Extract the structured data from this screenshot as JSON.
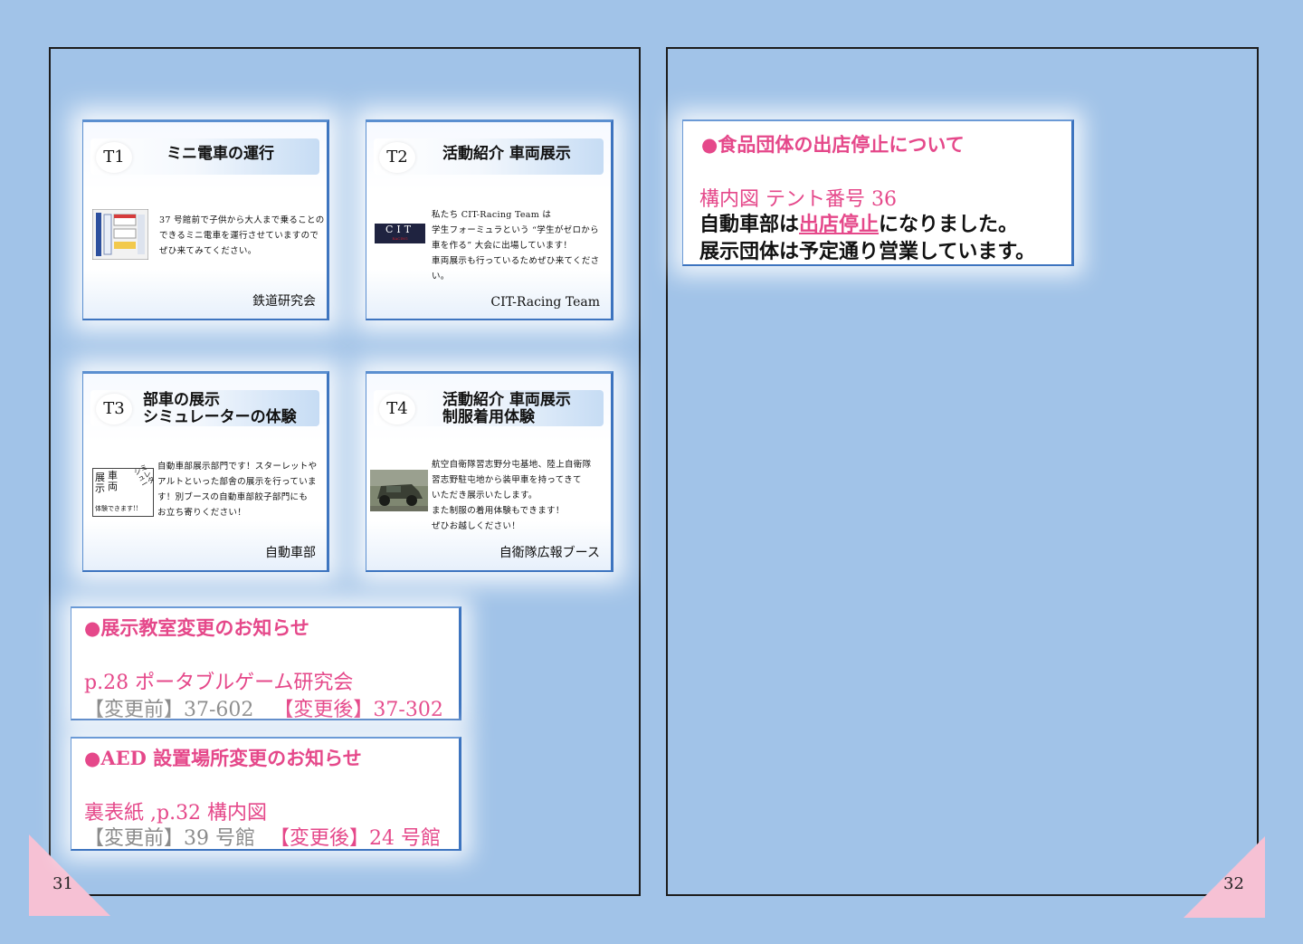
{
  "pages": {
    "left_number": "31",
    "right_number": "32"
  },
  "cards": [
    {
      "code": "T1",
      "title": "ミニ電車の運行",
      "body": [
        "37 号館前で子供から大人まで乗ることの",
        "できるミニ電車を運行させていますので",
        "ぜひ来てみてください。"
      ],
      "org": "鉄道研究会",
      "thumb_icon": "mini-train-sign"
    },
    {
      "code": "T2",
      "title": "活動紹介 車両展示",
      "body": [
        "私たち CIT-Racing Team は",
        "学生フォーミュラという “学生がゼロから",
        "車を作る” 大会に出場しています！",
        "車両展示も行っているためぜひ来てください。"
      ],
      "org": "CIT-Racing Team",
      "logo": {
        "main": "CIT",
        "sub": "RACING"
      }
    },
    {
      "code": "T3",
      "title_line1": "部車の展示",
      "title_line2": "シミュレーターの体験",
      "body": [
        "自動車部展示部門です！スターレットや",
        "アルトといった部舎の展示を行っていま",
        "す！別ブースの自動車部餃子部門にも",
        "お立ち寄りください！"
      ],
      "org": "自動車部",
      "sign": {
        "col1": "展示",
        "col2": "車両",
        "col3": "体験できます!!",
        "side": "シミュレータ"
      }
    },
    {
      "code": "T4",
      "title_line1": "活動紹介 車両展示",
      "title_line2": "制服着用体験",
      "body": [
        "航空自衛隊習志野分屯基地、陸上自衛隊",
        "習志野駐屯地から装甲車を持ってきて",
        "いただき展示いたします。",
        "また制服の着用体験もできます！",
        "ぜひお越しください！"
      ],
      "org": "自衛隊広報ブース",
      "thumb_icon": "armored-vehicle-photo"
    }
  ],
  "notice_classroom": {
    "heading": "●展示教室変更のお知らせ",
    "target": "p.28 ポータブルゲーム研究会",
    "before_label": "【変更前】37-602",
    "after_label": "【変更後】37-302"
  },
  "notice_aed": {
    "heading": "●AED 設置場所変更のお知らせ",
    "target": "裏表紙 ,p.32  構内図",
    "before_label": "【変更前】39 号館",
    "after_label": "【変更後】24 号館"
  },
  "notice_food": {
    "heading": "●食品団体の出店停止について",
    "target": "構内図 テント番号 36",
    "line2_pre": "自動車部は",
    "line2_emph": "出店停止",
    "line2_post": "になりました。",
    "line3": "展示団体は予定通り営業しています。"
  },
  "colors": {
    "background": "#a1c3e8",
    "accent_pink": "#e5488a",
    "card_border": "#3d74bf",
    "corner": "#f6c1d4"
  }
}
